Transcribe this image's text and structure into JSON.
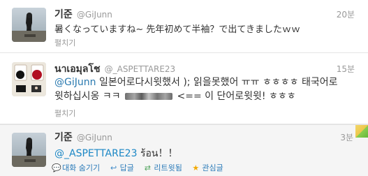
{
  "tweets": [
    {
      "name": "기준",
      "handle": "@GiJunn",
      "time": "20분",
      "text": "暑くなっていますね~ 先年初めて半袖？で出てきましたｗｗ",
      "expand": "펼치기"
    },
    {
      "name": "นาเอมุลโช",
      "handle": "@_ASPETTARE23",
      "time": "15분",
      "mention": "@GiJunn",
      "text_a": " 일본어로다시윗했서 ); 읽을못했어 ㅠㅠ ㅎㅎㅎㅎ 태국어로",
      "text_b": "윗하십시옹 ㅋㅋ",
      "text_c": " <== 이 단어로윗윗! ㅎㅎㅎ",
      "expand": "펼치기"
    },
    {
      "name": "기준",
      "handle": "@GiJunn",
      "time": "3분",
      "mention": "@_ASPETTARE23",
      "text": " ร้อน！！",
      "actions": {
        "conversation": "대화 숨기기",
        "reply": "답글",
        "retweet": "리트윗됨",
        "favorite": "관심글"
      }
    }
  ],
  "icons": {
    "reply": "reply-icon",
    "retweet": "retweet-icon",
    "favorite": "star-icon",
    "conversation": "speech-bubble-icon"
  }
}
